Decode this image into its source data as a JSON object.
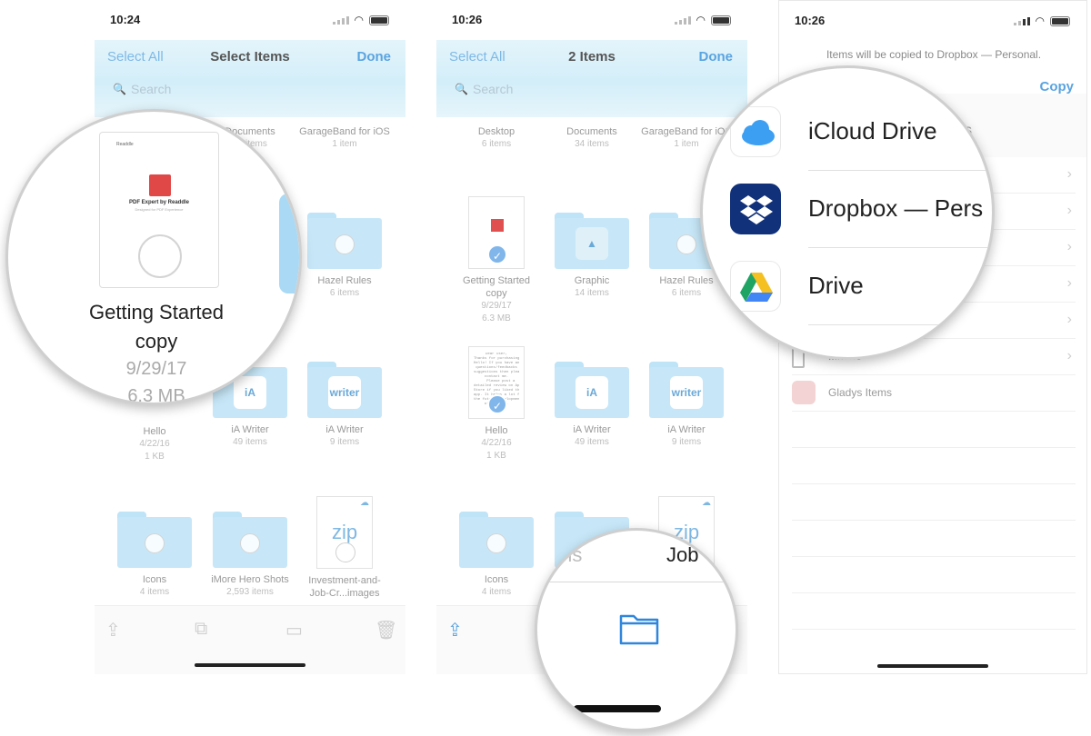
{
  "colors": {
    "accent": "#5aa4e0",
    "folder": "#c7e7f8",
    "selection": "#80b6ea"
  },
  "screen1": {
    "time": "10:24",
    "nav": {
      "left": "Select All",
      "title": "Select Items",
      "right": "Done"
    },
    "search_placeholder": "Search",
    "items": [
      {
        "name": "Documents",
        "meta": "34 items"
      },
      {
        "name": "GarageBand for iOS",
        "meta": "1 item"
      },
      {
        "name": "Hazel Rules",
        "meta": "6 items"
      },
      {
        "name": "Hello",
        "meta": "4/22/16",
        "meta2": "1 KB"
      },
      {
        "name": "iA Writer",
        "meta": "49 items"
      },
      {
        "name": "iA Writer",
        "meta": "9 items"
      },
      {
        "name": "Icons",
        "meta": "4 items"
      },
      {
        "name": "iMore Hero Shots",
        "meta": "2,593 items"
      },
      {
        "name": "Investment-and-Job-Cr...images",
        "meta": ""
      }
    ],
    "magnified": {
      "brand": "Readdle",
      "doc_title": "PDF Expert by Readdle",
      "doc_sub": "Designed for PDF Experience",
      "name_line1": "Getting Started",
      "name_line2": "copy",
      "date": "9/29/17",
      "size": "6.3 MB"
    }
  },
  "screen2": {
    "time": "10:26",
    "nav": {
      "left": "Select All",
      "title": "2 Items",
      "right": "Done"
    },
    "search_placeholder": "Search",
    "items": [
      {
        "name": "Desktop",
        "meta": "6 items"
      },
      {
        "name": "Documents",
        "meta": "34 items"
      },
      {
        "name": "GarageBand for iOS",
        "meta": "1 item"
      },
      {
        "name": "Getting Started copy",
        "meta": "9/29/17",
        "meta2": "6.3 MB"
      },
      {
        "name": "Graphic",
        "meta": "14 items"
      },
      {
        "name": "Hazel Rules",
        "meta": "6 items"
      },
      {
        "name": "Hello",
        "meta": "4/22/16",
        "meta2": "1 KB"
      },
      {
        "name": "iA Writer",
        "meta": "49 items"
      },
      {
        "name": "iA Writer",
        "meta": "9 items"
      },
      {
        "name": "Icons",
        "meta": "4 items"
      }
    ],
    "magnified": {
      "left_text": "ms",
      "right_text": "Job"
    }
  },
  "screen3": {
    "time": "10:26",
    "hint": "Items will be copied to Dropbox — Personal.",
    "copy_label": "Copy",
    "partial_suffix": "s",
    "rows": [
      {
        "label": ""
      },
      {
        "label": ""
      },
      {
        "label": ""
      },
      {
        "label": ""
      },
      {
        "label": ""
      },
      {
        "label": "...hone"
      },
      {
        "label": "Gladys Items"
      }
    ],
    "magnified": [
      {
        "label": "iCloud Drive",
        "icon": "icloud-icon"
      },
      {
        "label": "Dropbox — Pers",
        "icon": "dropbox-icon"
      },
      {
        "label": "Drive",
        "icon": "google-drive-icon"
      }
    ]
  },
  "zip_label": "zip",
  "writer_label": "writer",
  "ia_label": "iA"
}
